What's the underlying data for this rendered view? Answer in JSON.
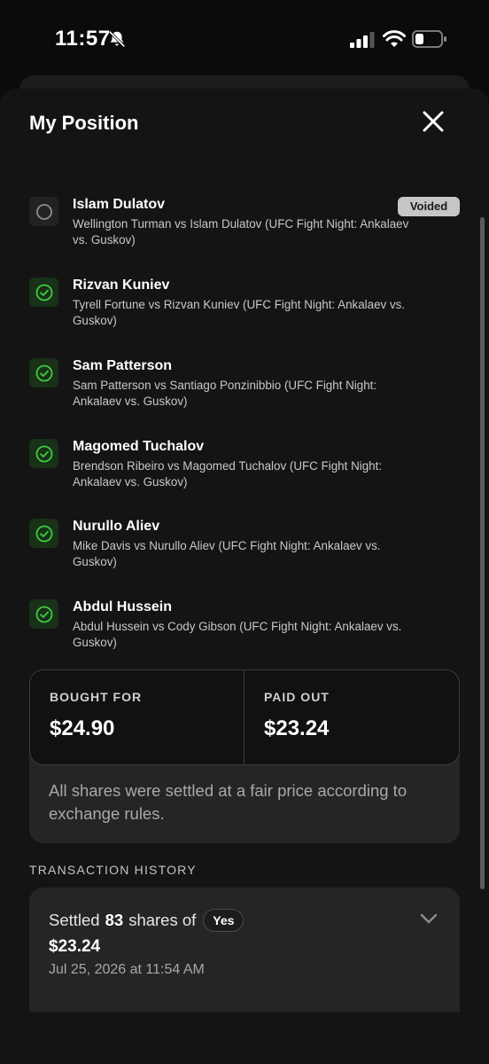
{
  "status_bar": {
    "time": "11:57",
    "icons": [
      "bell-slash-icon",
      "cellular-signal-icon",
      "wifi-icon",
      "battery-icon"
    ]
  },
  "sheet": {
    "title": "My Position",
    "close_icon": "close-icon"
  },
  "legs": [
    {
      "name": "Islam Dulatov",
      "description": "Wellington Turman vs Islam Dulatov (UFC Fight Night: Ankalaev vs. Guskov)",
      "status": "void",
      "badge": "Voided"
    },
    {
      "name": "Rizvan Kuniev",
      "description": "Tyrell Fortune vs Rizvan Kuniev (UFC Fight Night: Ankalaev vs. Guskov)",
      "status": "won"
    },
    {
      "name": "Sam Patterson",
      "description": "Sam Patterson vs Santiago Ponzinibbio (UFC Fight Night: Ankalaev vs. Guskov)",
      "status": "won"
    },
    {
      "name": "Magomed Tuchalov",
      "description": "Brendson Ribeiro vs Magomed Tuchalov (UFC Fight Night: Ankalaev vs. Guskov)",
      "status": "won"
    },
    {
      "name": "Nurullo Aliev",
      "description": "Mike Davis vs Nurullo Aliev (UFC Fight Night: Ankalaev vs. Guskov)",
      "status": "won"
    },
    {
      "name": "Abdul Hussein",
      "description": "Abdul Hussein vs Cody Gibson (UFC Fight Night: Ankalaev vs. Guskov)",
      "status": "won"
    }
  ],
  "summary": {
    "bought_label": "BOUGHT FOR",
    "bought_value": "$24.90",
    "paid_label": "PAID OUT",
    "paid_value": "$23.24",
    "note": "All shares were settled at a fair price according to exchange rules."
  },
  "transactions": {
    "header": "TRANSACTION HISTORY",
    "items": [
      {
        "prefix": "Settled",
        "shares": "83",
        "suffix": "shares of",
        "side": "Yes",
        "amount": "$23.24",
        "date": "Jul 25, 2026 at 11:54 AM"
      }
    ]
  },
  "colors": {
    "background": "#0b0b0b",
    "sheet": "#141414",
    "card": "#252527",
    "success": "#3ccf3c",
    "voided_badge": "#c6c6c6"
  }
}
